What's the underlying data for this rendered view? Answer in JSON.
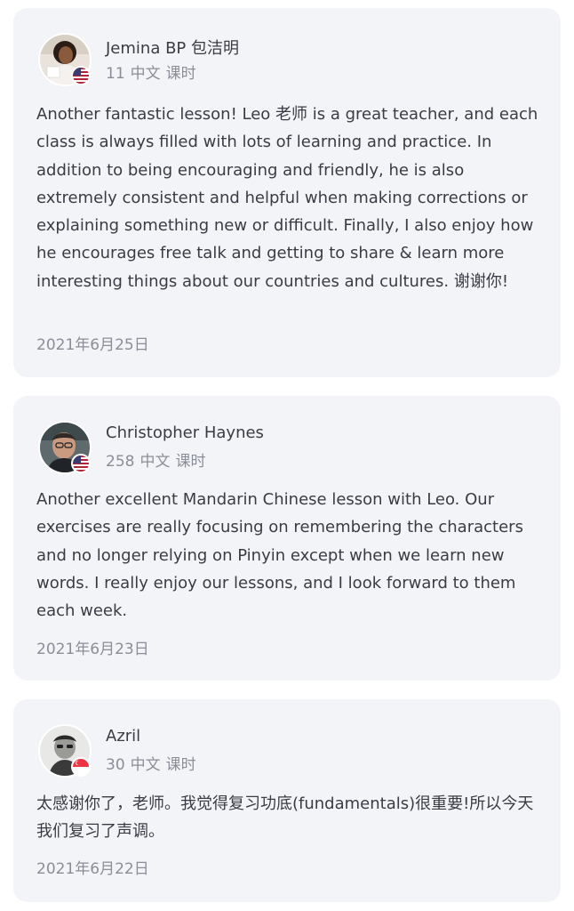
{
  "reviews": [
    {
      "name": "Jemina BP 包洁明",
      "lessons": "11",
      "language": "中文",
      "unit": "课时",
      "flag": "us-flag-icon",
      "text": "Another fantastic lesson! Leo 老师 is a great teacher, and each class is always filled with lots of learning and practice. In addition to being encouraging and friendly, he is also extremely consistent and helpful when making corrections or explaining something new or difficult. Finally, I also enjoy how he encourages free talk and getting to share & learn more interesting things about our countries and cultures. 谢谢你!",
      "date": "2021年6月25日"
    },
    {
      "name": "Christopher Haynes",
      "lessons": "258",
      "language": "中文",
      "unit": "课时",
      "flag": "us-flag-icon",
      "text": "Another excellent Mandarin Chinese lesson with Leo. Our exercises are really focusing on remembering the characters and no longer relying on Pinyin except when we learn new words. I really enjoy our lessons, and I look forward to them each week.",
      "date": "2021年6月23日"
    },
    {
      "name": "Azril",
      "lessons": "30",
      "language": "中文",
      "unit": "课时",
      "flag": "sg-flag-icon",
      "text": "太感谢你了，老师。我觉得复习功底(fundamentals)很重要!所以今天我们复习了声调。",
      "date": "2021年6月22日"
    }
  ],
  "colors": {
    "card_bg": "#f3f4f7",
    "text": "#3b3b45",
    "muted": "#8b8d98"
  }
}
